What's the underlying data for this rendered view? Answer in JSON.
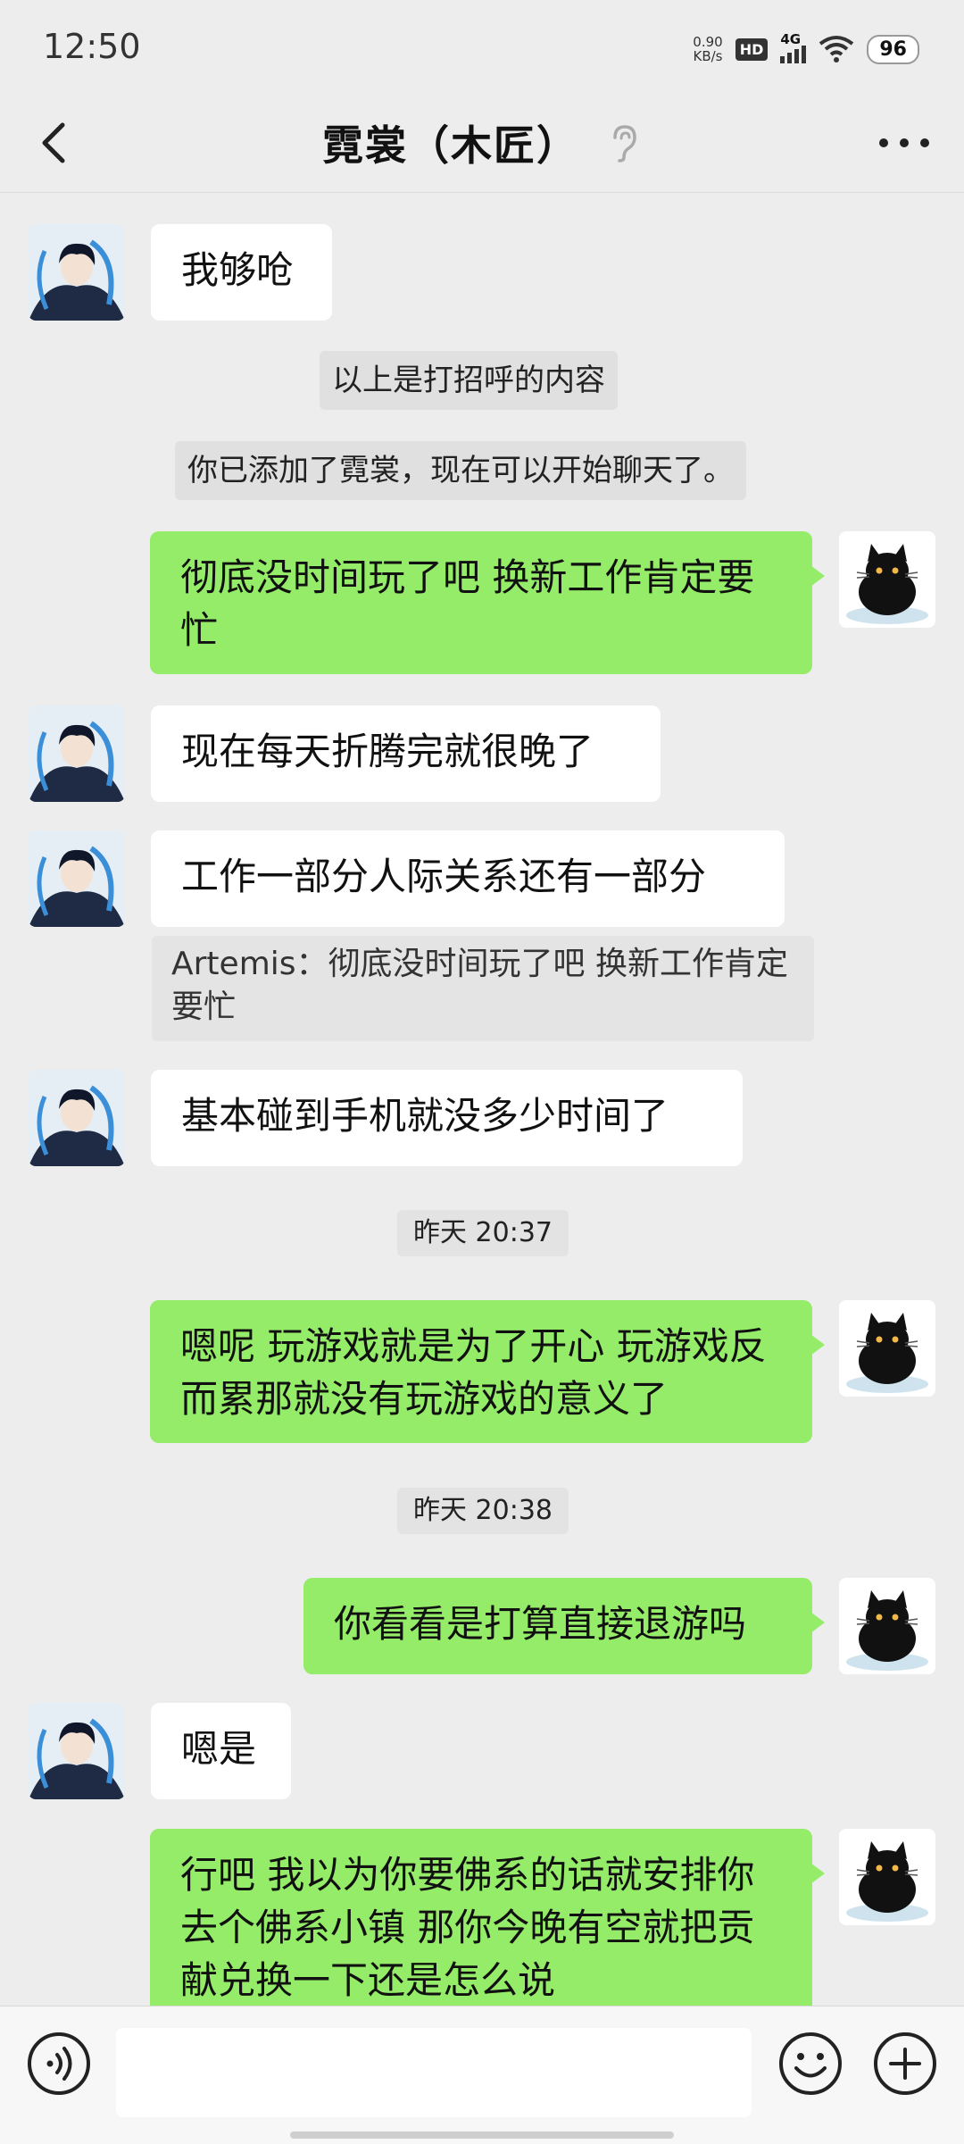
{
  "status_bar": {
    "time": "12:50",
    "net_speed_value": "0.90",
    "net_speed_unit": "KB/s",
    "hd": "HD",
    "network": "4G",
    "battery": "96"
  },
  "header": {
    "title": "霓裳（木匠）",
    "back_icon": "chevron-left-icon",
    "ear_icon": "ear-icon",
    "more_icon": "more-horizontal-icon"
  },
  "messages": [
    {
      "side": "in",
      "text": "我够呛"
    },
    {
      "side": "system",
      "text": "以上是打招呼的内容"
    },
    {
      "side": "system",
      "text": "你已添加了霓裳，现在可以开始聊天了。"
    },
    {
      "side": "out",
      "text": "彻底没时间玩了吧 换新工作肯定要忙"
    },
    {
      "side": "in",
      "text": "现在每天折腾完就很晚了"
    },
    {
      "side": "in",
      "text": "工作一部分人际关系还有一部分"
    },
    {
      "side": "quote",
      "text": "Artemis：彻底没时间玩了吧 换新工作肯定要忙"
    },
    {
      "side": "in",
      "text": "基本碰到手机就没多少时间了"
    },
    {
      "side": "time",
      "text": "昨天 20:37"
    },
    {
      "side": "out",
      "text": "嗯呢 玩游戏就是为了开心 玩游戏反而累那就没有玩游戏的意义了"
    },
    {
      "side": "time",
      "text": "昨天 20:38"
    },
    {
      "side": "out",
      "text": "你看看是打算直接退游吗"
    },
    {
      "side": "in",
      "text": "嗯是"
    },
    {
      "side": "out",
      "text": "行吧 我以为你要佛系的话就安排你去个佛系小镇 那你今晚有空就把贡献兑换一下还是怎么说"
    }
  ],
  "input_bar": {
    "voice_icon": "voice-icon",
    "placeholder": "",
    "emoji_icon": "emoji-icon",
    "plus_icon": "plus-icon"
  },
  "colors": {
    "background": "#ededed",
    "outgoing_bubble": "#95ec69",
    "incoming_bubble": "#ffffff"
  }
}
